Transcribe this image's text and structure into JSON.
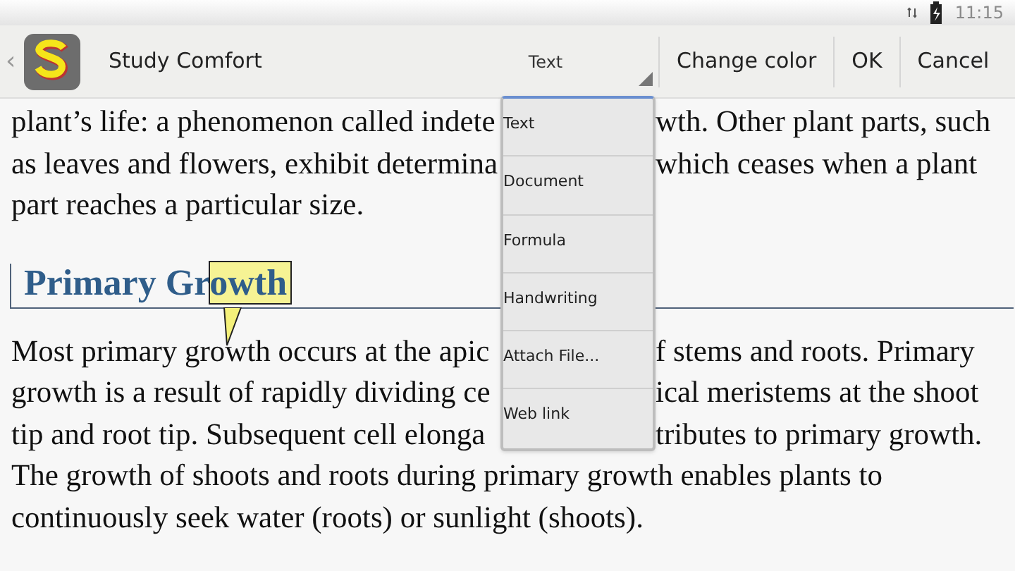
{
  "status_bar": {
    "time": "11:15"
  },
  "action_bar": {
    "back": "‹",
    "app_title": "Study Comfort",
    "spinner": "Text",
    "actions": [
      "Change color",
      "OK",
      "Cancel"
    ]
  },
  "content": {
    "paragraph_1": [
      [
        "plant’s life: a phenomenon called indete",
        "wth. Other plant parts, such"
      ],
      [
        "as leaves and flowers, exhibit determina",
        "which ceases when a plant"
      ],
      [
        "part reaches a particular size."
      ]
    ],
    "heading": {
      "text": "Primary Gr",
      "highlighted": "owth"
    },
    "paragraph_2": [
      [
        "Most primary growth occurs at the apic",
        "f stems and roots. Primary"
      ],
      [
        "growth is a result of rapidly dividing ce",
        "ical meristems at the shoot"
      ],
      [
        "tip and root tip. Subsequent cell elonga",
        "tributes to primary growth."
      ],
      [
        "The growth of shoots and roots during primary growth enables plants to"
      ],
      [
        "continuously seek water (roots) or sunlight (shoots)."
      ]
    ]
  },
  "menu": {
    "items": [
      "Text",
      "Document",
      "Formula",
      "Handwriting",
      "Attach File...",
      "Web link"
    ]
  }
}
